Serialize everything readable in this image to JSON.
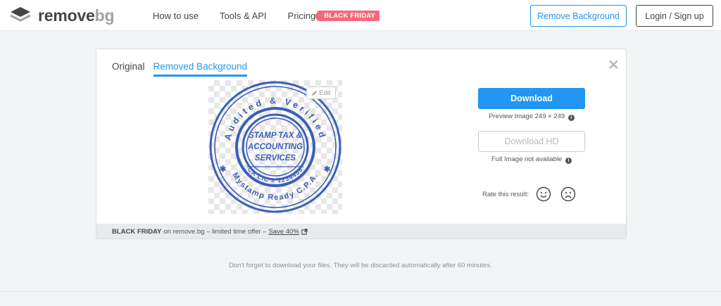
{
  "header": {
    "logo": {
      "word_main": "remove",
      "word_accent": "bg",
      "icon": "layers-logo-icon"
    },
    "nav": {
      "how_to_use": "How to use",
      "tools_api": "Tools & API",
      "pricing": "Pricing",
      "badge": "BLACK FRIDAY"
    },
    "remove_background": "Remove Background",
    "login": "Login / Sign up"
  },
  "result": {
    "tabs": {
      "original": "Original",
      "removed": "Removed Background",
      "active": "removed"
    },
    "close_icon": "close-icon",
    "edit_label": "Edit",
    "stamp": {
      "top_text": "Audited & Verified",
      "bottom_text": "Mystamp Ready C.P.A.",
      "inner_text": "CA LIC # 1234456",
      "center_line1": "STAMP TAX &",
      "center_line2": "ACCOUNTING",
      "center_line3": "SERVICES",
      "color": "#3a5fb8"
    },
    "download_label": "Download",
    "preview_info": "Preview Image 249 × 249",
    "download_hd_label": "Download HD",
    "hd_info": "Full Image not available",
    "rate_label": "Rate this result:",
    "promo": {
      "bold": "BLACK FRIDAY",
      "text": "on remove.bg – limited time offer –",
      "link": "Save 40%"
    }
  },
  "footer_note": "Don't forget to download your files. They will be discarded automatically after 60 minutes.",
  "colors": {
    "accent": "#2196f3",
    "badge": "#f2697c",
    "text": "#454545"
  }
}
